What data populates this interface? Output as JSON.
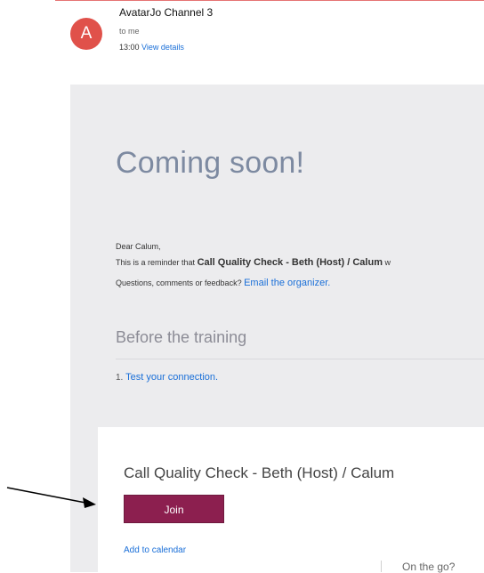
{
  "email": {
    "avatar_letter": "A",
    "sender": "AvatarJo Channel 3",
    "recipient": "to me",
    "time": "13:00",
    "details_link": "View details"
  },
  "body": {
    "heading": "Coming soon!",
    "greeting": "Dear Calum,",
    "reminder_prefix": "This is a reminder that",
    "reminder_bold": "Call Quality Check - Beth (Host) / Calum",
    "reminder_suffix": "w",
    "questions_text": "Questions, comments or feedback?",
    "email_organizer_link": "Email the organizer.",
    "section_title": "Before the training",
    "step_number": "1.",
    "step_link": "Test your connection."
  },
  "meeting_card": {
    "title": "Call Quality Check - Beth (Host) / Calum",
    "join_label": "Join",
    "add_calendar": "Add to calendar",
    "on_the_go": "On the go?"
  },
  "colors": {
    "avatar": "#e0514a",
    "join_button": "#8c1f4f",
    "link": "#1a6fd8",
    "panel_background": "#ececee"
  }
}
